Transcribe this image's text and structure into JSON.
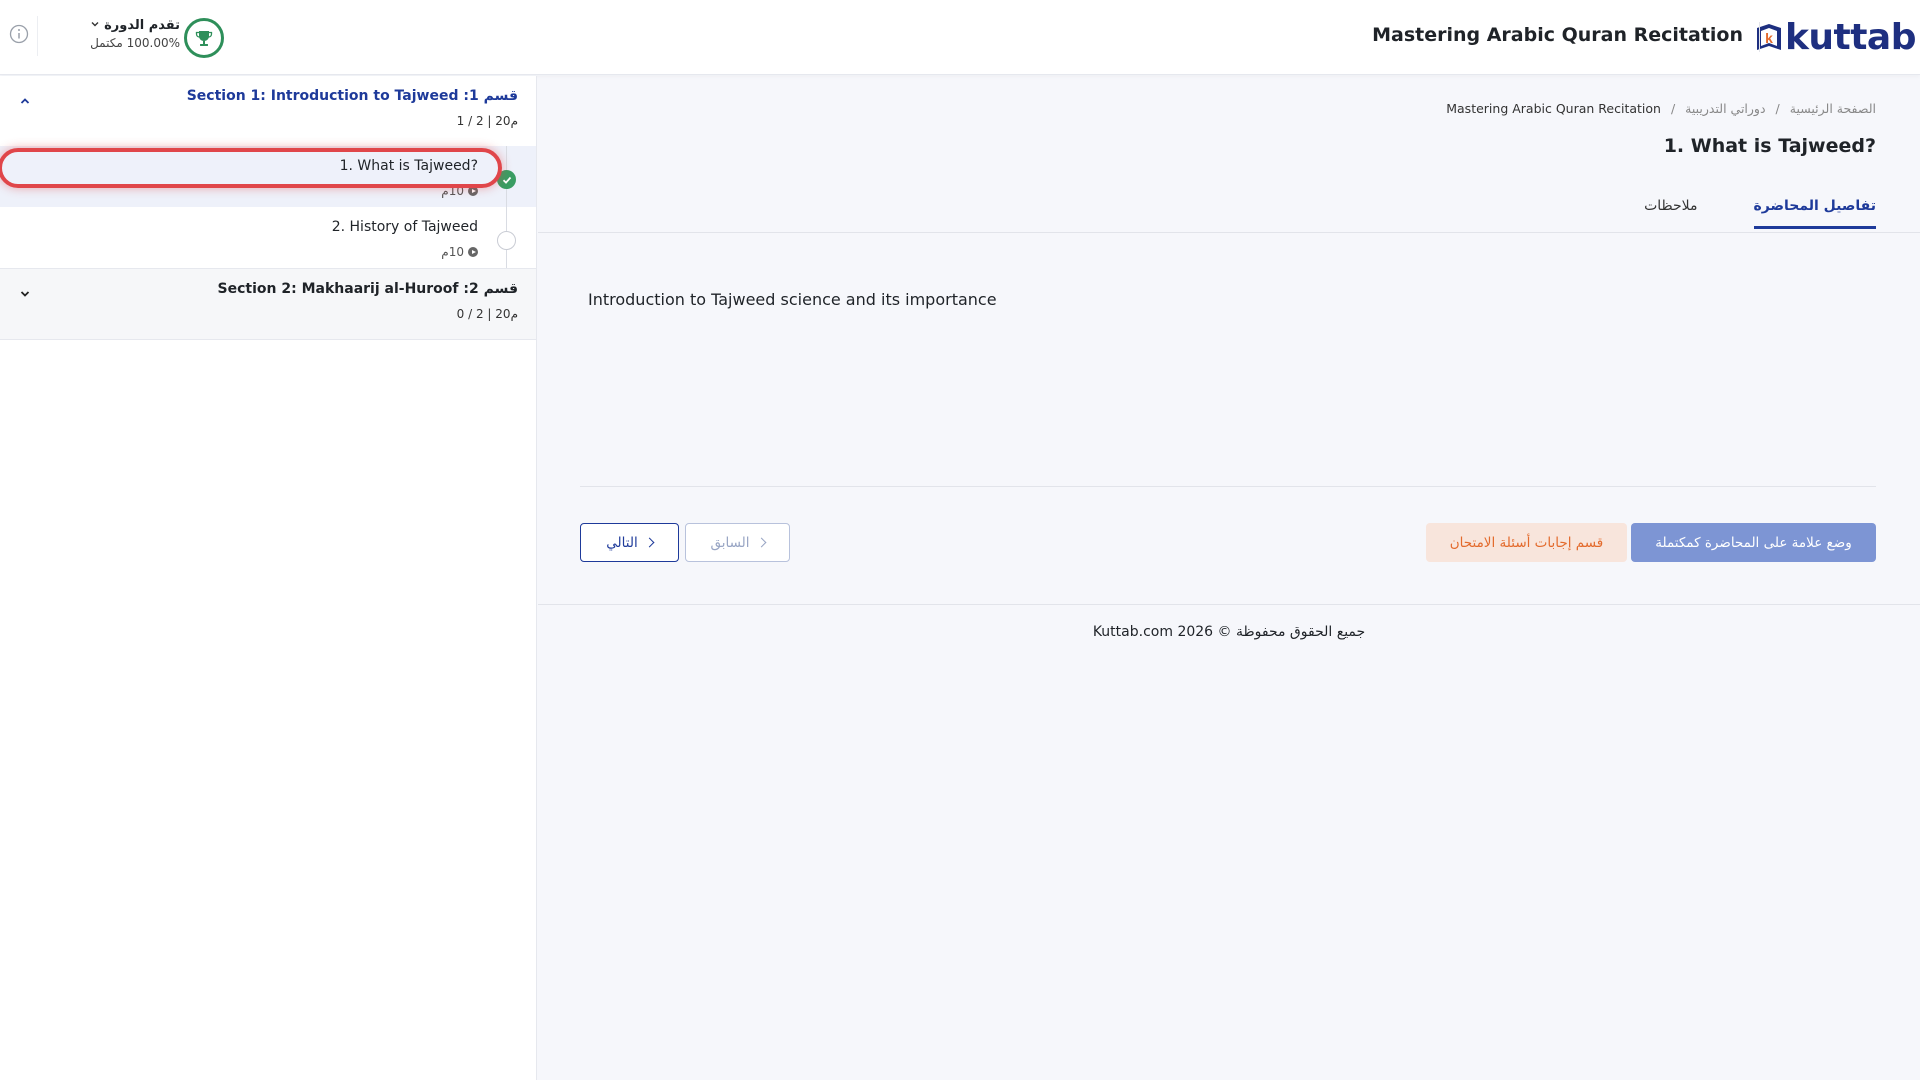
{
  "header": {
    "logo_text": "kuttab",
    "course_title": "Mastering Arabic Quran Recitation",
    "progress_label": "تقدم الدورة",
    "progress_value": "100.00% مكتمل",
    "info_icon": "info-icon",
    "trophy_icon": "trophy-icon"
  },
  "sidebar": {
    "sections": [
      {
        "title": "قسم 1: Section 1: Introduction to Tajweed",
        "meta": "1 / 2 | 20م",
        "expanded": true,
        "lectures": [
          {
            "title": "1. What is Tajweed?",
            "duration": "10م",
            "completed": true,
            "active": true
          },
          {
            "title": "2. History of Tajweed",
            "duration": "10م",
            "completed": false,
            "active": false
          }
        ]
      },
      {
        "title": "قسم 2: Section 2: Makhaarij al-Huroof",
        "meta": "0 / 2 | 20م",
        "expanded": false
      }
    ]
  },
  "main": {
    "breadcrumb": [
      "الصفحة الرئيسية",
      "/",
      "دوراتي التدريبية",
      "/",
      "Mastering Arabic Quran Recitation"
    ],
    "lecture_heading": "1. What is Tajweed?",
    "tabs": [
      {
        "label": "تفاصيل المحاضرة",
        "active": true
      },
      {
        "label": "ملاحظات",
        "active": false
      }
    ],
    "description": "Introduction to Tajweed science and its importance",
    "buttons": {
      "mark_complete": "وضع علامة على المحاضرة كمكتملة",
      "quiz_answers": "قسم إجابات أسئلة الامتحان",
      "previous": "السابق",
      "next": "التالي"
    },
    "footer": "جميع الحقوق محفوظة © 2026 Kuttab.com"
  },
  "colors": {
    "brand": "#1e2f80",
    "accent": "#1e3a9a",
    "success": "#3a9d63",
    "highlight": "#e0464a",
    "quiz_text": "#e36a2c"
  }
}
